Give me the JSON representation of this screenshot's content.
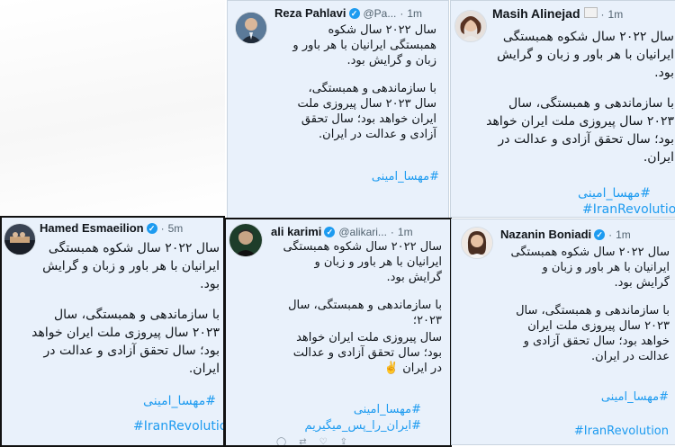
{
  "tweet_text": {
    "para1": "سال ۲۰۲۲ سال شکوه همبستگی ایرانیان با هر باور و زبان و گرایش بود.",
    "para2": "با سازماندهی و همبستگی، سال ۲۰۲۳ سال پیروزی ملت ایران خواهد بود؛ سال تحقق آزادی و عدالت در ایران.",
    "para2_karimi_a": "با سازماندهی و همبستگی، سال ۲۰۲۳؛",
    "para2_karimi_b": "سال پیروزی ملت ایران خواهد بود؛ سال تحقق آزادی و عدالت در ایران ✌️"
  },
  "hashtags": {
    "mahsa": "#مهسا_امینی",
    "iran_revolution": "#IranRevolution",
    "iran_ra_pas": "#ایران_را_پس_میگیریم"
  },
  "tweets": [
    {
      "id": "reza",
      "name": "Reza Pahlavi",
      "handle": "@Pa...",
      "time": "1m",
      "verified": true
    },
    {
      "id": "masih",
      "name": "Masih Alinejad",
      "handle": "",
      "time": "1m",
      "verified": false
    },
    {
      "id": "hamed",
      "name": "Hamed Esmaeilion",
      "handle": "",
      "time": "5m",
      "verified": true
    },
    {
      "id": "ali",
      "name": "ali karimi",
      "handle": "@alikari...",
      "time": "1m",
      "verified": true
    },
    {
      "id": "nazanin",
      "name": "Nazanin Boniadi",
      "handle": "",
      "time": "1m",
      "verified": true
    }
  ],
  "colors": {
    "card_bg": "#e9f1fb",
    "link": "#1d9bf0",
    "text": "#0f1419",
    "meta": "#536471",
    "verified": "#1d9bf0"
  },
  "icons": [
    "verified-badge-icon",
    "flag-icon",
    "reply-icon",
    "retweet-icon",
    "like-icon",
    "share-icon"
  ]
}
